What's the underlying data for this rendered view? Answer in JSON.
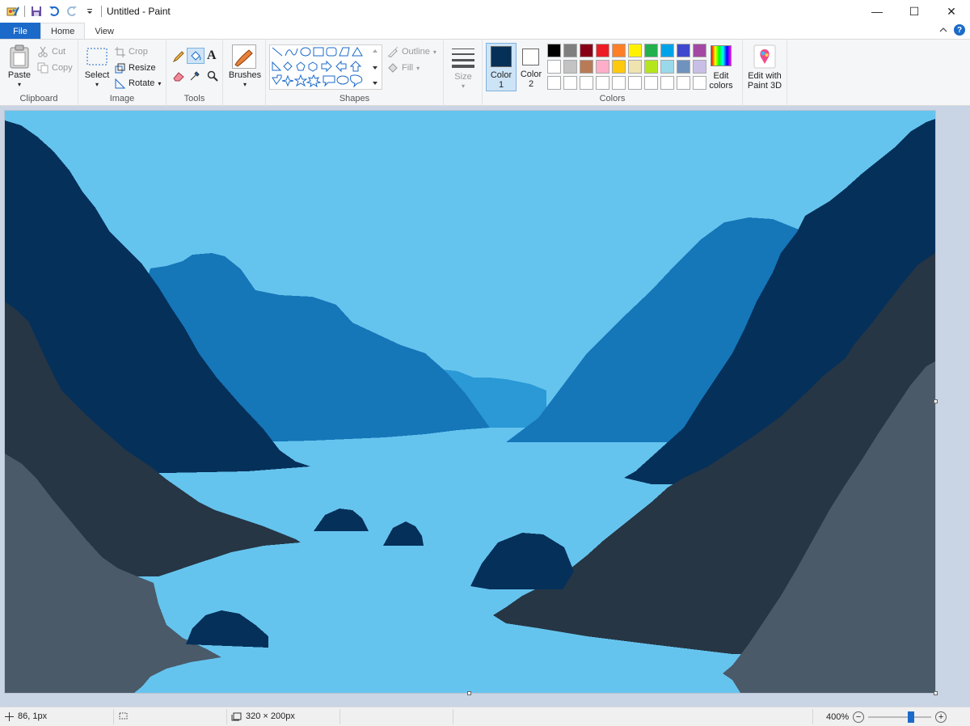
{
  "window": {
    "title": "Untitled - Paint",
    "minimize": "—",
    "maximize": "☐",
    "close": "✕"
  },
  "tabs": {
    "file": "File",
    "home": "Home",
    "view": "View"
  },
  "ribbon": {
    "clipboard": {
      "label": "Clipboard",
      "paste": "Paste",
      "cut": "Cut",
      "copy": "Copy"
    },
    "image": {
      "label": "Image",
      "select": "Select",
      "crop": "Crop",
      "resize": "Resize",
      "rotate": "Rotate"
    },
    "tools": {
      "label": "Tools"
    },
    "brushes": {
      "label": "Brushes"
    },
    "shapes": {
      "label": "Shapes",
      "outline": "Outline",
      "fill": "Fill"
    },
    "size": {
      "label": "Size"
    },
    "colors": {
      "label": "Colors",
      "color1_label": "Color",
      "color1_num": "1",
      "color2_label": "Color",
      "color2_num": "2",
      "color1_value": "#063057",
      "color2_value": "#ffffff",
      "edit_colors_line1": "Edit",
      "edit_colors_line2": "colors",
      "palette_row1": [
        "#000000",
        "#7f7f7f",
        "#880015",
        "#ed1c24",
        "#ff7f27",
        "#fff200",
        "#22b14c",
        "#00a2e8",
        "#3f48cc",
        "#a349a4"
      ],
      "palette_row2": [
        "#ffffff",
        "#c3c3c3",
        "#b97a57",
        "#ffaec9",
        "#ffc90e",
        "#efe4b0",
        "#b5e61d",
        "#99d9ea",
        "#7092be",
        "#c8bfe7"
      ],
      "palette_row3": [
        "#ffffff",
        "#ffffff",
        "#ffffff",
        "#ffffff",
        "#ffffff",
        "#ffffff",
        "#ffffff",
        "#ffffff",
        "#ffffff",
        "#ffffff"
      ]
    },
    "paint3d": {
      "line1": "Edit with",
      "line2": "Paint 3D"
    }
  },
  "canvas": {
    "sky_color": "#65c4ee",
    "far_mountain_color": "#2a99d6",
    "mid_mountain_color": "#1576b8",
    "near_mountain_color": "#05305a",
    "dark_hill_color": "#263645",
    "gray_hill_color": "#4a5a69"
  },
  "status": {
    "cursor_pos": "86, 1px",
    "image_size": "320 × 200px",
    "zoom": "400%"
  }
}
